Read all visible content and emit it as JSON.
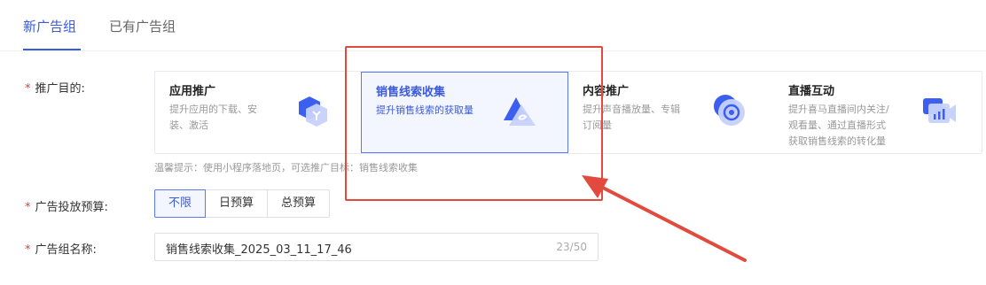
{
  "tabs": [
    {
      "label": "新广告组",
      "active": true
    },
    {
      "label": "已有广告组",
      "active": false
    }
  ],
  "form": {
    "goal_label": "推广目的:",
    "budget_label": "广告投放预算:",
    "name_label": "广告组名称:",
    "required_mark": "*"
  },
  "goals": [
    {
      "title": "应用推广",
      "desc_lines": [
        "提升应用的下载、安",
        "装、激活"
      ],
      "icon": "app-promotion-icon",
      "selected": false
    },
    {
      "title": "销售线索收集",
      "desc_lines": [
        "提升销售线索的获取量"
      ],
      "icon": "lead-collection-icon",
      "selected": true
    },
    {
      "title": "内容推广",
      "desc_lines": [
        "提升声音播放量、专辑",
        "订阅量"
      ],
      "icon": "content-promotion-icon",
      "selected": false
    },
    {
      "title": "直播互动",
      "desc_lines": [
        "提升喜马直播间内关注/",
        "观看量、通过直播形式",
        "获取销售线索的转化量"
      ],
      "icon": "live-interaction-icon",
      "selected": false
    }
  ],
  "hint": "温馨提示：使用小程序落地页，可选推广目标：销售线索收集",
  "budget_options": [
    {
      "label": "不限",
      "active": true
    },
    {
      "label": "日预算",
      "active": false
    },
    {
      "label": "总预算",
      "active": false
    }
  ],
  "name_input": {
    "value": "销售线索收集_2025_03_11_17_46",
    "counter": "23/50"
  },
  "colors": {
    "accent": "#3b5bdb",
    "annotation": "#e14a3c",
    "required": "#e03e36"
  }
}
